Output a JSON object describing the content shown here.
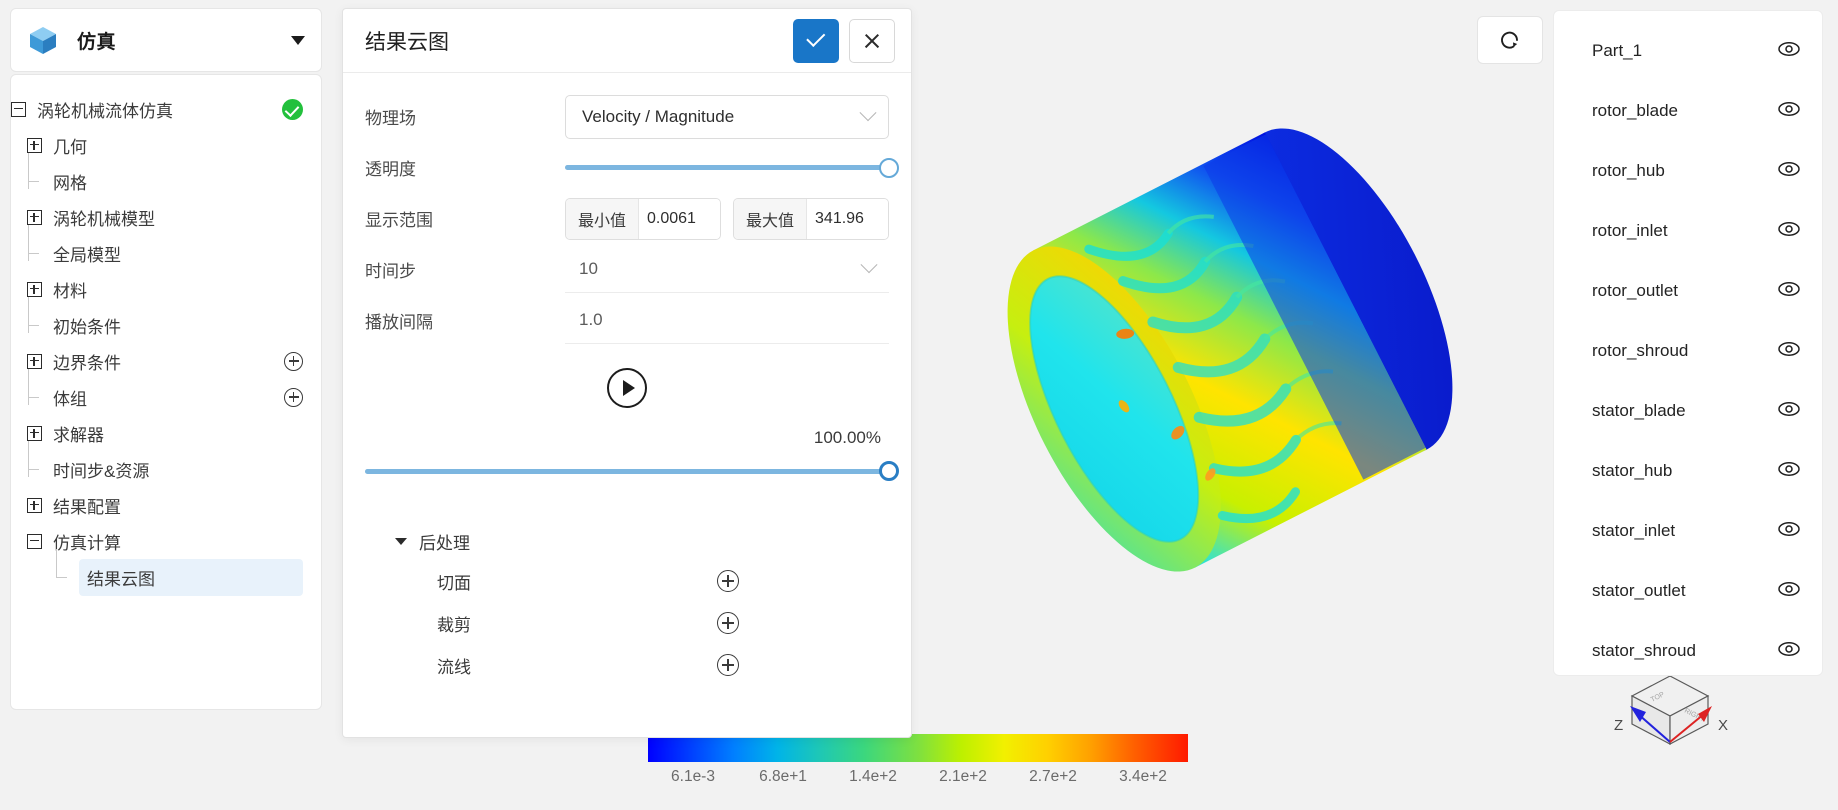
{
  "app": {
    "title": "仿真",
    "logo_icon": "cube-icon",
    "dropdown_icon": "chevron-down-icon"
  },
  "tree": {
    "root": {
      "label": "涡轮机械流体仿真",
      "status_icon": "check-badge-icon"
    },
    "items": [
      {
        "label": "几何",
        "type": "branch",
        "expander": "plus",
        "indent": 1,
        "add": false
      },
      {
        "label": "网格",
        "type": "leaf",
        "indent": 2,
        "add": false
      },
      {
        "label": "涡轮机械模型",
        "type": "branch",
        "expander": "plus",
        "indent": 1,
        "add": false
      },
      {
        "label": "全局模型",
        "type": "leaf",
        "indent": 2,
        "add": false
      },
      {
        "label": "材料",
        "type": "branch",
        "expander": "plus",
        "indent": 1,
        "add": false
      },
      {
        "label": "初始条件",
        "type": "leaf",
        "indent": 2,
        "add": false
      },
      {
        "label": "边界条件",
        "type": "branch",
        "expander": "plus",
        "indent": 1,
        "add": true
      },
      {
        "label": "体组",
        "type": "leaf",
        "indent": 2,
        "add": true
      },
      {
        "label": "求解器",
        "type": "branch",
        "expander": "plus",
        "indent": 1,
        "add": false
      },
      {
        "label": "时间步&资源",
        "type": "leaf",
        "indent": 2,
        "add": false
      },
      {
        "label": "结果配置",
        "type": "branch",
        "expander": "plus",
        "indent": 1,
        "add": false
      },
      {
        "label": "仿真计算",
        "type": "branch",
        "expander": "minus",
        "indent": 1,
        "add": false
      },
      {
        "label": "结果云图",
        "type": "leaf",
        "indent": 2,
        "add": false,
        "selected": true
      }
    ]
  },
  "dialog": {
    "title": "结果云图",
    "confirm_icon": "check-icon",
    "cancel_icon": "close-icon",
    "fields": {
      "field_label": "物理场",
      "field_value": "Velocity / Magnitude",
      "opacity_label": "透明度",
      "opacity_percent": 100,
      "range_label": "显示范围",
      "range_min_label": "最小值",
      "range_min_value": "0.0061",
      "range_max_label": "最大值",
      "range_max_value": "341.96",
      "timestep_label": "时间步",
      "timestep_value": "10",
      "interval_label": "播放间隔",
      "interval_value": "1.0"
    },
    "play": {
      "play_icon": "play-circle-icon",
      "progress_text": "100.00%",
      "progress_percent": 100
    },
    "post": {
      "header": "后处理",
      "items": [
        {
          "label": "切面",
          "add_icon": "plus-circle-icon"
        },
        {
          "label": "裁剪",
          "add_icon": "plus-circle-icon"
        },
        {
          "label": "流线",
          "add_icon": "plus-circle-icon"
        }
      ]
    }
  },
  "toolbar": {
    "reset_view_icon": "rotate-reset-icon"
  },
  "parts": {
    "items": [
      {
        "label": "Part_1",
        "visibility_icon": "eye-icon"
      },
      {
        "label": "rotor_blade",
        "visibility_icon": "eye-icon"
      },
      {
        "label": "rotor_hub",
        "visibility_icon": "eye-icon"
      },
      {
        "label": "rotor_inlet",
        "visibility_icon": "eye-icon"
      },
      {
        "label": "rotor_outlet",
        "visibility_icon": "eye-icon"
      },
      {
        "label": "rotor_shroud",
        "visibility_icon": "eye-icon"
      },
      {
        "label": "stator_blade",
        "visibility_icon": "eye-icon"
      },
      {
        "label": "stator_hub",
        "visibility_icon": "eye-icon"
      },
      {
        "label": "stator_inlet",
        "visibility_icon": "eye-icon"
      },
      {
        "label": "stator_outlet",
        "visibility_icon": "eye-icon"
      },
      {
        "label": "stator_shroud",
        "visibility_icon": "eye-icon"
      }
    ]
  },
  "colorbar": {
    "ticks": [
      "6.1e-3",
      "6.8e+1",
      "1.4e+2",
      "2.1e+2",
      "2.7e+2",
      "3.4e+2"
    ],
    "min": 0.0061,
    "max": 341.96
  },
  "axes": {
    "z_label": "Z",
    "x_label": "X",
    "z_color": "#2222dd",
    "x_color": "#dd2222"
  },
  "colors": {
    "accent": "#1976c8",
    "slider": "#7cb6e0",
    "knob": "#2a7ec4",
    "ok_green": "#22c03c",
    "selection_bg": "#e8f2fb"
  }
}
